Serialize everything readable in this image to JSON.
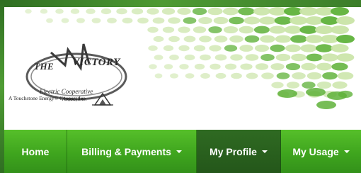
{
  "logo": {
    "the": "THE",
    "victory": "VICTORY",
    "line1": "Electric Cooperative",
    "line2": "Assoc, Inc.",
    "tagline": "A Touchstone Energy® Cooperative"
  },
  "nav": {
    "items": [
      {
        "label": "Home",
        "has_dropdown": false,
        "active": false
      },
      {
        "label": "Billing & Payments",
        "has_dropdown": true,
        "active": false
      },
      {
        "label": "My Profile",
        "has_dropdown": true,
        "active": true
      },
      {
        "label": "My Usage",
        "has_dropdown": true,
        "active": false
      }
    ]
  },
  "colors": {
    "nav_green": "#3fa51e",
    "nav_active": "#2a6020",
    "frame_green": "#3f7d2c",
    "dot_light": "#c9e4a6",
    "dot_dark": "#5fb23a"
  },
  "icons": {
    "caret": "chevron-down-icon",
    "touchstone": "touchstone-energy-icon"
  }
}
